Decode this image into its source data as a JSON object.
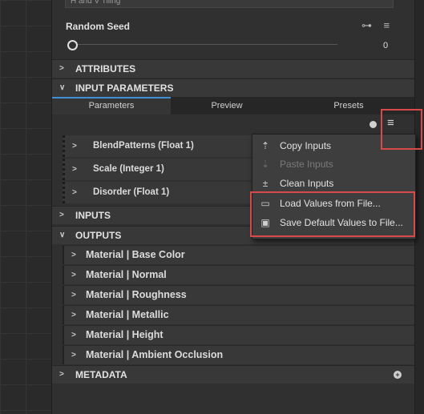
{
  "panel": {
    "tiling_value": "H and V Tiling",
    "random_seed": {
      "label": "Random Seed",
      "value": "0",
      "slider_fraction": 0.0
    },
    "sections": {
      "attributes": "ATTRIBUTES",
      "input_parameters": "INPUT PARAMETERS",
      "inputs": "INPUTS",
      "outputs": "OUTPUTS",
      "metadata": "METADATA"
    },
    "tabs": [
      {
        "label": "Parameters",
        "active": true
      },
      {
        "label": "Preview",
        "active": false
      },
      {
        "label": "Presets",
        "active": false
      }
    ],
    "parameters": [
      {
        "label": "BlendPatterns (Float 1)"
      },
      {
        "label": "Scale (Integer 1)"
      },
      {
        "label": "Disorder (Float 1)"
      }
    ],
    "outputs": [
      {
        "label": "Material | Base Color"
      },
      {
        "label": "Material | Normal"
      },
      {
        "label": "Material | Roughness"
      },
      {
        "label": "Material | Metallic"
      },
      {
        "label": "Material | Height"
      },
      {
        "label": "Material | Ambient Occlusion"
      }
    ]
  },
  "context_menu": {
    "items": [
      {
        "label": "Copy Inputs",
        "icon": "upload-icon",
        "enabled": true
      },
      {
        "label": "Paste Inputs",
        "icon": "download-icon",
        "enabled": false
      },
      {
        "label": "Clean Inputs",
        "icon": "clean-icon",
        "enabled": true
      },
      {
        "label": "Load Values from File...",
        "icon": "folder-open-icon",
        "enabled": true
      },
      {
        "label": "Save Default Values to File...",
        "icon": "floppy-disk-icon",
        "enabled": true
      }
    ]
  },
  "colors": {
    "accent_tab": "#3d8fd8",
    "highlight_box": "#d84a4a"
  }
}
